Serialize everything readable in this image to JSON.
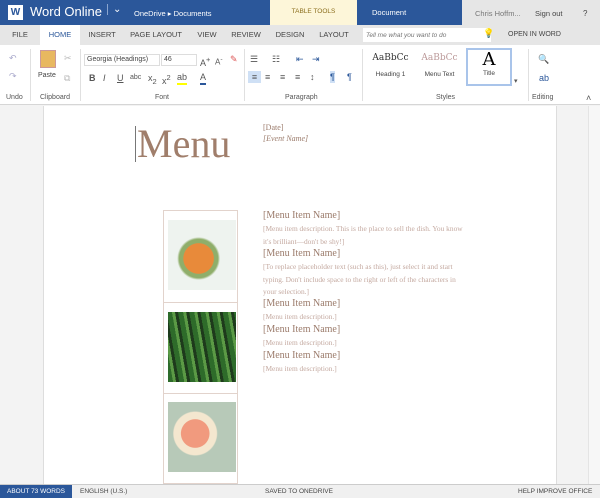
{
  "app": {
    "title": "Word Online",
    "breadcrumb": [
      "OneDrive",
      "Documents"
    ],
    "context_tab": "TABLE TOOLS",
    "document": "Document",
    "user": "Chris Hoffm...",
    "sign_out": "Sign out",
    "help": "?"
  },
  "tabs": [
    "FILE",
    "HOME",
    "INSERT",
    "PAGE LAYOUT",
    "VIEW",
    "REVIEW",
    "DESIGN",
    "LAYOUT"
  ],
  "tell_me_placeholder": "Tell me what you want to do",
  "open_in_word": "OPEN IN WORD",
  "ribbon": {
    "paste": "Paste",
    "font_name": "Georgia (Headings)",
    "font_size": "46",
    "styles": [
      "AaBbCc",
      "AaBbCc",
      "A"
    ],
    "style_names": [
      "Heading 1",
      "Menu Text",
      "Title"
    ],
    "groups": [
      "Undo",
      "Clipboard",
      "Font",
      "Paragraph",
      "Styles",
      "Editing"
    ]
  },
  "doc": {
    "title": "Menu",
    "date": "[Date]",
    "event": "[Event Name]",
    "items": [
      {
        "name": "[Menu Item Name]",
        "desc": "[Menu item description. This is the place to sell the dish. You know it's brilliant—don't be shy!]"
      },
      {
        "name": "[Menu Item Name]",
        "desc": "[To replace placeholder text (such as this), just select it and start typing. Don't include space to the right or left of the characters in your selection.]"
      },
      {
        "name": "[Menu Item Name]",
        "desc": "[Menu item description.]"
      },
      {
        "name": "[Menu Item Name]",
        "desc": "[Menu item description.]"
      },
      {
        "name": "[Menu Item Name]",
        "desc": "[Menu item description.]"
      }
    ]
  },
  "status": {
    "words": "ABOUT 73 WORDS",
    "language": "ENGLISH (U.S.)",
    "saved": "SAVED TO ONEDRIVE",
    "help": "HELP IMPROVE OFFICE"
  },
  "colors": {
    "brand": "#2b579a",
    "accent_text": "#9b7b6b",
    "context": "#fdf6d9"
  }
}
